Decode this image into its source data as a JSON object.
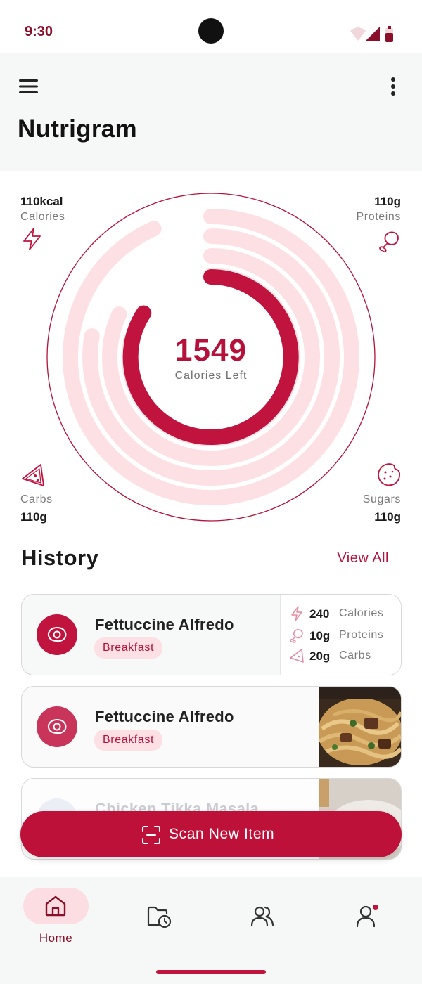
{
  "status_bar": {
    "time": "9:30"
  },
  "header": {
    "title": "Nutrigram",
    "menu_icon": "hamburger-menu-icon",
    "more_icon": "more-vertical-icon"
  },
  "summary": {
    "calories_left": "1549",
    "calories_left_label": "Calories Left",
    "macros": {
      "calories": {
        "value": "110kcal",
        "label": "Calories",
        "icon": "lightning-icon"
      },
      "proteins": {
        "value": "110g",
        "label": "Proteins",
        "icon": "drumstick-icon"
      },
      "carbs": {
        "value": "110g",
        "label": "Carbs",
        "icon": "pizza-slice-icon"
      },
      "sugars": {
        "value": "110g",
        "label": "Sugars",
        "icon": "cookie-icon"
      }
    },
    "colors": {
      "accent": "#bd1139",
      "ring_track": "#fde0e4"
    }
  },
  "history": {
    "title": "History",
    "view_all": "View All",
    "items": [
      {
        "name": "Fettuccine Alfredo",
        "tag": "Breakfast",
        "stats": [
          {
            "value": "240",
            "label": "Calories",
            "icon": "lightning-icon"
          },
          {
            "value": "10g",
            "label": "Proteins",
            "icon": "drumstick-icon"
          },
          {
            "value": "20g",
            "label": "Carbs",
            "icon": "pizza-slice-icon"
          }
        ]
      },
      {
        "name": "Fettuccine Alfredo",
        "tag": "Breakfast",
        "photo": "pasta-photo"
      },
      {
        "name": "Chicken Tikka Masala",
        "photo": "dish-photo"
      }
    ]
  },
  "scan_button": {
    "label": "Scan New Item",
    "icon": "scan-icon"
  },
  "bottom_nav": {
    "items": [
      {
        "label": "Home",
        "icon": "home-icon",
        "active": true
      },
      {
        "label": "",
        "icon": "history-folder-icon"
      },
      {
        "label": "",
        "icon": "community-icon"
      },
      {
        "label": "",
        "icon": "profile-icon"
      }
    ]
  }
}
